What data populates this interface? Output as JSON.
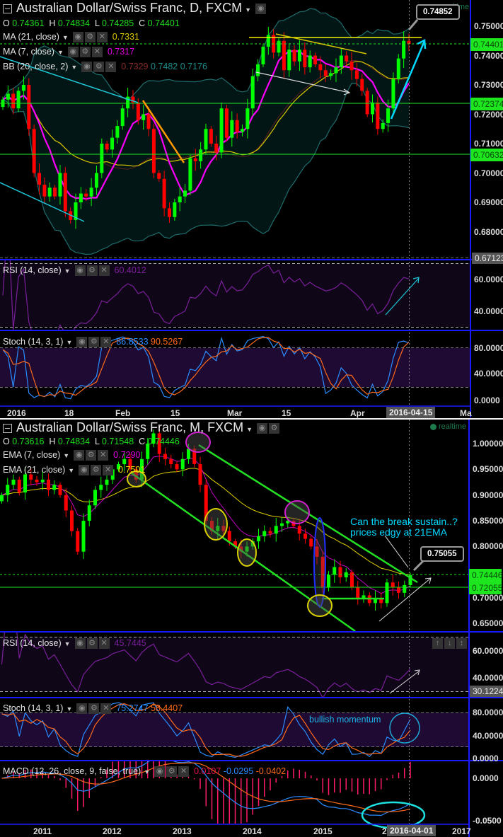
{
  "daily": {
    "title": "Australian Dollar/Swiss Franc, D, FXCM",
    "ohlc": {
      "o_label": "O",
      "o": "0.74361",
      "h_label": "H",
      "h": "0.74834",
      "l_label": "L",
      "l": "0.74285",
      "c_label": "C",
      "c": "0.74401"
    },
    "ma21": {
      "label": "MA (21, close)",
      "value": "0.7331"
    },
    "ma7": {
      "label": "MA (7, close)",
      "value": "0.7317"
    },
    "bb": {
      "label": "BB (20, close, 2)",
      "mid": "0.7329",
      "upper": "0.7482",
      "lower": "0.7176"
    },
    "rsi": {
      "label": "RSI (14, close)",
      "value": "60.4012"
    },
    "stoch": {
      "label": "Stoch (14, 3, 1)",
      "k": "86.8533",
      "d": "90.5267"
    },
    "realtime": "realtime",
    "price_ticks": [
      "0.75000",
      "0.74000",
      "0.73000",
      "0.72000",
      "0.71000",
      "0.70000",
      "0.69000",
      "0.68000"
    ],
    "price_tags": {
      "last": "0.74401",
      "level1": "0.72374",
      "level2": "0.70632",
      "low": "0.67123"
    },
    "callout": "0.74852",
    "rsi_ticks": [
      "60.0000",
      "40.0000"
    ],
    "stoch_ticks": [
      "80.0000",
      "40.0000",
      "0.0000"
    ],
    "time_ticks": [
      "2016",
      "18",
      "Feb",
      "15",
      "Mar",
      "15",
      "Apr",
      "Ma"
    ],
    "cursor_date": "2016-04-15"
  },
  "monthly": {
    "title": "Australian Dollar/Swiss Franc, M, FXCM",
    "ohlc": {
      "o_label": "O",
      "o": "0.73616",
      "h_label": "H",
      "h": "0.74834",
      "l_label": "L",
      "l": "0.71548",
      "c_label": "C",
      "c": "0.74446"
    },
    "ema7": {
      "label": "EMA (7, close)",
      "value": "0.7290"
    },
    "ema21": {
      "label": "EMA (21, close)",
      "value": "0.7501"
    },
    "rsi": {
      "label": "RSI (14, close)",
      "value": "45.7445"
    },
    "stoch": {
      "label": "Stoch (14, 3, 1)",
      "k": "75.2747",
      "d": "58.4407"
    },
    "macd": {
      "label": "MACD (12, 26, close, 9, false, true)",
      "hist": "0.0107",
      "macd": "-0.0295",
      "signal": "-0.0402"
    },
    "realtime": "realtime",
    "price_ticks": [
      "1.00000",
      "0.95000",
      "0.90000",
      "0.85000",
      "0.80000",
      "0.70000",
      "0.65000"
    ],
    "price_tags": {
      "last": "0.74446",
      "level1": "0.72055"
    },
    "callout": "0.75055",
    "rsi_ticks": [
      "60.0000",
      "40.0000"
    ],
    "rsi_low_tag": "30.1224",
    "stoch_ticks": [
      "80.0000",
      "40.0000",
      "0.0000"
    ],
    "macd_ticks": [
      "0.0000",
      "-0.0500"
    ],
    "time_ticks": [
      "2011",
      "2012",
      "2013",
      "2014",
      "2015",
      "2",
      "2017"
    ],
    "cursor_date": "2016-04-01",
    "annotation_line1": "Can the break sustain..?",
    "annotation_line2": "prices edgy at 21EMA",
    "stoch_annotation": "bullish momentum"
  },
  "colors": {
    "up": "#00ff00",
    "down": "#ff0000",
    "ma7": "#ff00ff",
    "ma21": "#d8c800",
    "bb": "#1f6b6b",
    "stoch_k": "#2a8cff",
    "stoch_d": "#ff6a1a",
    "rsi": "#7a1f9a",
    "hist": "#ff1a6a",
    "level": "#1ee61e"
  },
  "chart_data": [
    {
      "type": "candlestick",
      "title": "Australian Dollar/Swiss Franc, D, FXCM",
      "x_range": [
        "2015-12-31",
        "2016-04-15"
      ],
      "ylim": [
        0.67123,
        0.755
      ],
      "series": [
        {
          "name": "close",
          "values": [
            0.725,
            0.727,
            0.722,
            0.728,
            0.73,
            0.715,
            0.7,
            0.696,
            0.692,
            0.695,
            0.692,
            0.7,
            0.687,
            0.684,
            0.69,
            0.693,
            0.692,
            0.695,
            0.7,
            0.71,
            0.708,
            0.712,
            0.716,
            0.722,
            0.726,
            0.724,
            0.718,
            0.72,
            0.715,
            0.7,
            0.698,
            0.688,
            0.685,
            0.69,
            0.692,
            0.694,
            0.705,
            0.704,
            0.708,
            0.715,
            0.71,
            0.707,
            0.722,
            0.712,
            0.718,
            0.714,
            0.715,
            0.722,
            0.733,
            0.737,
            0.743,
            0.747,
            0.741,
            0.745,
            0.735,
            0.742,
            0.738,
            0.742,
            0.736,
            0.74,
            0.737,
            0.735,
            0.733,
            0.734,
            0.736,
            0.74,
            0.738,
            0.735,
            0.732,
            0.728,
            0.72,
            0.724,
            0.715,
            0.717,
            0.722,
            0.732,
            0.739,
            0.745,
            0.744
          ]
        }
      ],
      "horizontal_levels": [
        0.72374,
        0.70632
      ],
      "indicators": [
        "MA 21",
        "MA 7",
        "BB 20,2",
        "RSI 14",
        "Stoch 14,3,1"
      ]
    },
    {
      "type": "candlestick",
      "title": "Australian Dollar/Swiss Franc, M, FXCM",
      "x_range": [
        "2010-06",
        "2016-04"
      ],
      "ylim": [
        0.63,
        1.05
      ],
      "series": [
        {
          "name": "close",
          "values": [
            0.9,
            0.92,
            0.93,
            0.905,
            0.94,
            0.93,
            0.925,
            0.93,
            0.91,
            0.92,
            0.9,
            0.87,
            0.83,
            0.79,
            0.85,
            0.88,
            0.91,
            0.92,
            0.93,
            0.95,
            0.96,
            0.97,
            0.95,
            0.93,
            0.97,
            1.0,
            1.02,
            0.98,
            0.97,
            0.96,
            0.95,
            0.97,
            0.99,
            0.96,
            0.92,
            0.85,
            0.83,
            0.84,
            0.83,
            0.81,
            0.8,
            0.79,
            0.8,
            0.81,
            0.82,
            0.83,
            0.825,
            0.84,
            0.845,
            0.85,
            0.84,
            0.825,
            0.815,
            0.8,
            0.78,
            0.72,
            0.745,
            0.76,
            0.74,
            0.75,
            0.72,
            0.7,
            0.705,
            0.69,
            0.7,
            0.69,
            0.73,
            0.72,
            0.71,
            0.725,
            0.744
          ]
        }
      ],
      "horizontal_levels": [
        0.72055
      ],
      "indicators": [
        "EMA 7",
        "EMA 21",
        "RSI 14",
        "Stoch 14,3,1",
        "MACD 12,26,9"
      ]
    }
  ]
}
